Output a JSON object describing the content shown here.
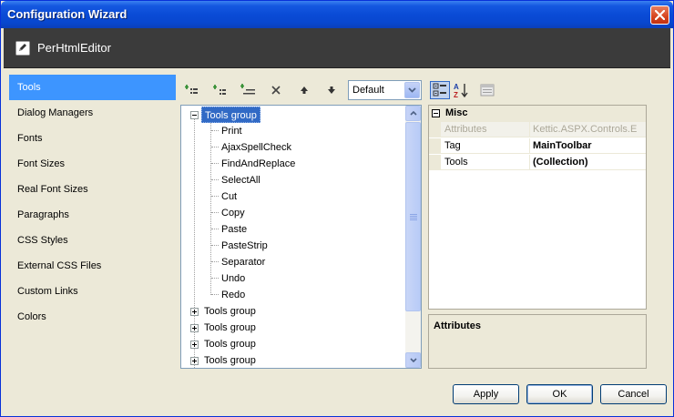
{
  "window": {
    "title": "Configuration Wizard"
  },
  "header": {
    "title": "PerHtmlEditor"
  },
  "nav": {
    "items": [
      {
        "label": "Tools",
        "selected": true
      },
      {
        "label": "Dialog Managers"
      },
      {
        "label": "Fonts"
      },
      {
        "label": "Font Sizes"
      },
      {
        "label": "Real Font Sizes"
      },
      {
        "label": "Paragraphs"
      },
      {
        "label": "CSS Styles"
      },
      {
        "label": "External CSS Files"
      },
      {
        "label": "Custom Links"
      },
      {
        "label": "Colors"
      }
    ]
  },
  "toolbar": {
    "icons": [
      "add-group-icon",
      "add-tool-icon",
      "add-separator-icon",
      "delete-icon",
      "move-up-icon",
      "move-down-icon"
    ],
    "mode_select": {
      "value": "Default"
    }
  },
  "tree": {
    "expanded_group": {
      "label": "Tools group",
      "children": [
        "Print",
        "AjaxSpellCheck",
        "FindAndReplace",
        "SelectAll",
        "Cut",
        "Copy",
        "Paste",
        "PasteStrip",
        "Separator",
        "Undo",
        "Redo"
      ]
    },
    "collapsed_groups": [
      "Tools group",
      "Tools group",
      "Tools group",
      "Tools group"
    ]
  },
  "property_grid": {
    "category": "Misc",
    "rows": [
      {
        "name": "Attributes",
        "value": "Kettic.ASPX.Controls.E",
        "readonly": true
      },
      {
        "name": "Tag",
        "value": "MainToolbar"
      },
      {
        "name": "Tools",
        "value": "(Collection)"
      }
    ],
    "description_title": "Attributes"
  },
  "buttons": {
    "apply": "Apply",
    "ok": "OK",
    "cancel": "Cancel"
  },
  "colors": {
    "titlebar": "#0a4bd6",
    "selection": "#3d95ff",
    "tree_selection": "#316ac5",
    "header_band": "#3b3b3b"
  }
}
